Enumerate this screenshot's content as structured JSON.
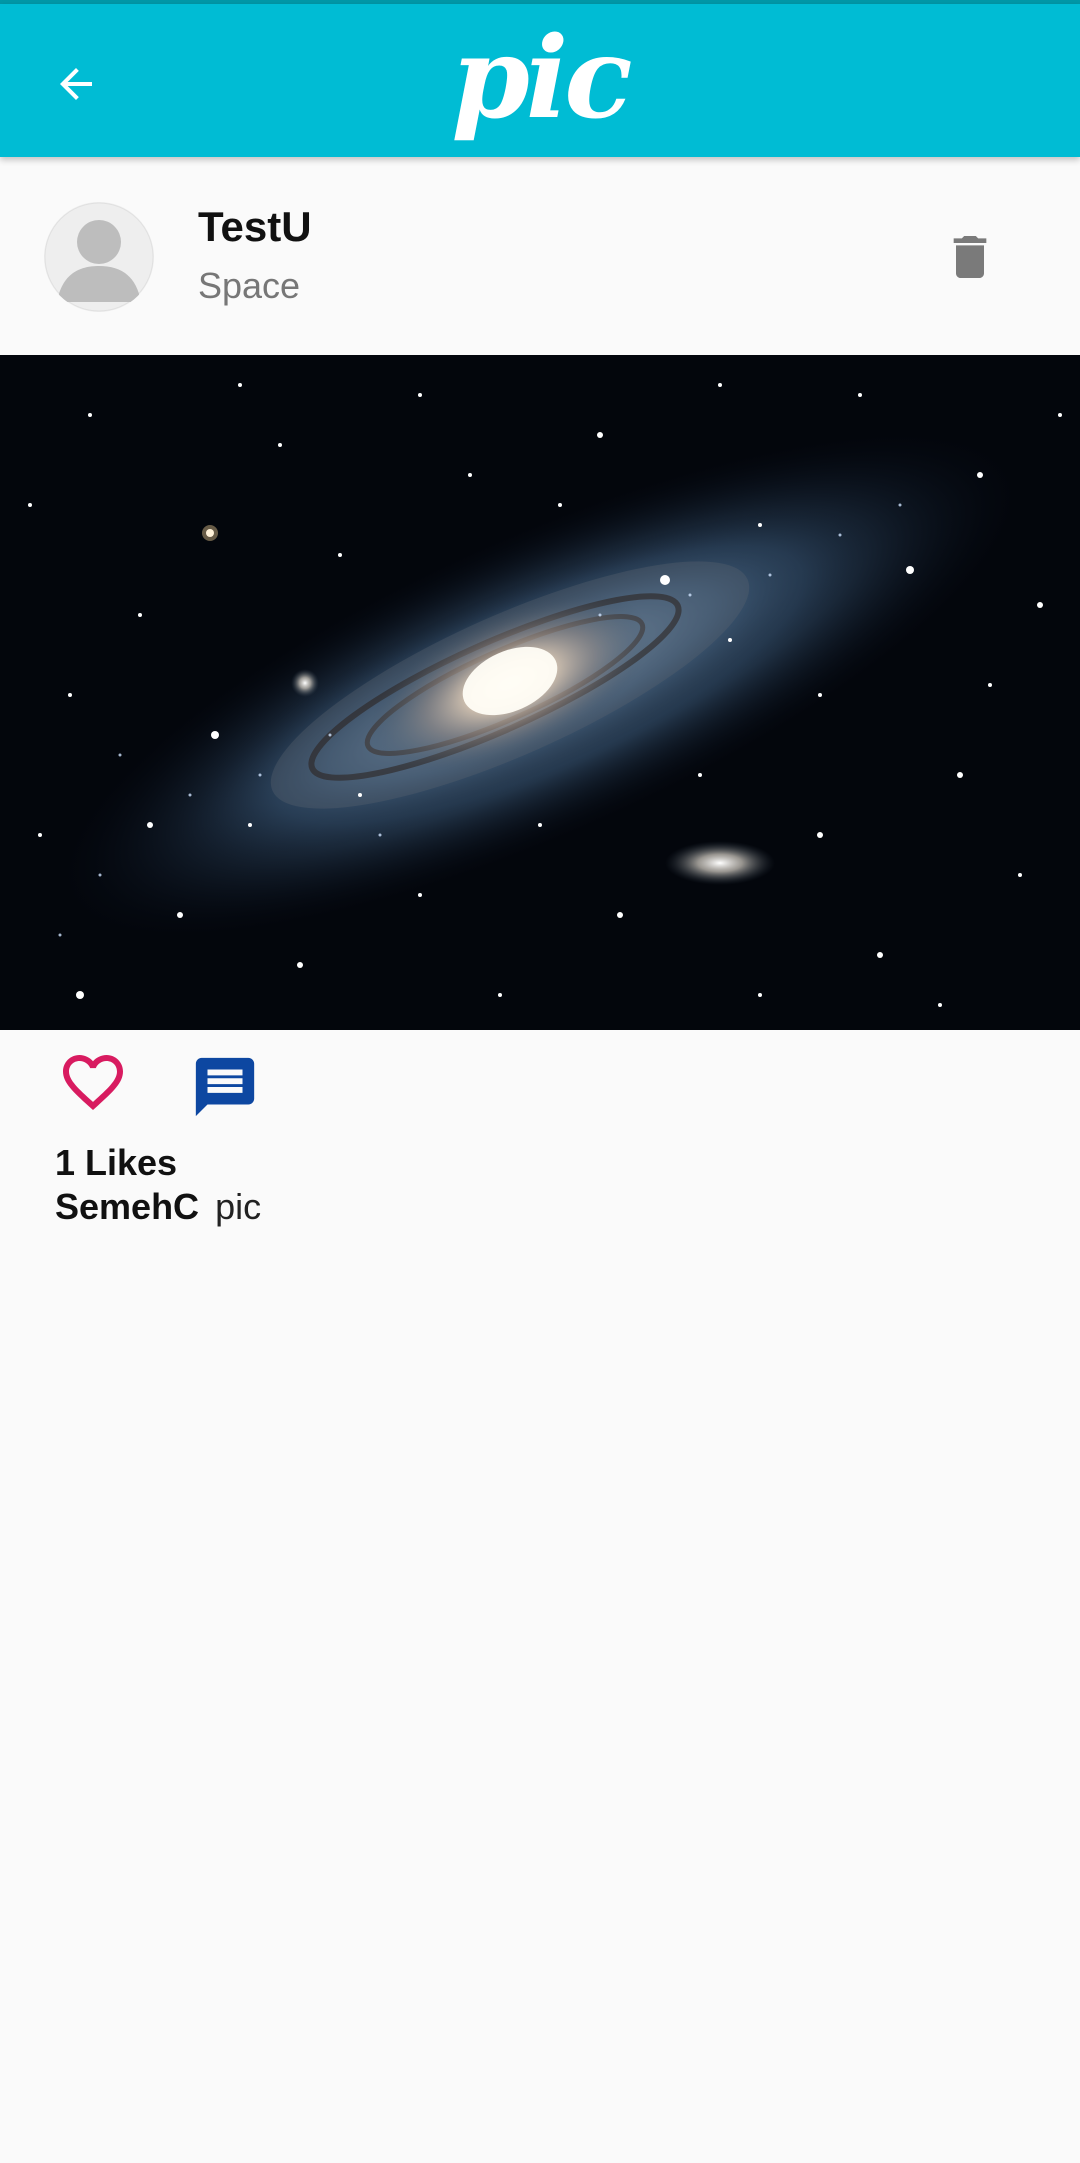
{
  "appbar": {
    "title": "pic",
    "back_icon": "arrow-back-icon",
    "background_color": "#00bcd4"
  },
  "post": {
    "username": "TestU",
    "category": "Space",
    "avatar_icon": "default-avatar-icon",
    "delete_icon": "trash-icon",
    "image_subject": "galaxy-photo",
    "like_icon": "heart-outline-icon",
    "comment_icon": "comment-icon",
    "likes_label": "1 Likes",
    "caption_user": "SemehC",
    "caption_text": "pic"
  },
  "colors": {
    "accent": "#00bcd4",
    "like": "#d81b60",
    "comment": "#0d47a1"
  }
}
